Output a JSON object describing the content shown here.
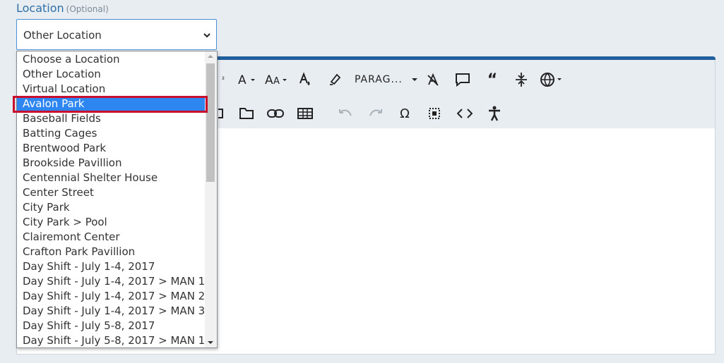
{
  "field": {
    "label": "Location",
    "optional": "(Optional)",
    "value": "Other Location"
  },
  "toolbar": {
    "paragraph": "PARAG..."
  },
  "options": [
    "Choose a Location",
    "Other Location",
    "Virtual Location",
    "Avalon Park",
    "Baseball Fields",
    "Batting Cages",
    "Brentwood Park",
    "Brookside Pavillion",
    "Centennial Shelter House",
    "Center Street",
    "City Park",
    "City Park > Pool",
    "Clairemont Center",
    "Crafton Park Pavillion",
    "Day Shift - July 1-4, 2017",
    "Day Shift - July 1-4, 2017 > MAN 1",
    "Day Shift - July 1-4, 2017 > MAN 2",
    "Day Shift - July 1-4, 2017 > MAN 3",
    "Day Shift - July 5-8, 2017",
    "Day Shift - July 5-8, 2017 > MAN 1"
  ],
  "selected_option": "Avalon Park",
  "colors": {
    "accent": "#2e6fa7",
    "selection": "#2e86f0",
    "highlight": "#c8102e",
    "editor_bar": "#1f5f9c"
  }
}
